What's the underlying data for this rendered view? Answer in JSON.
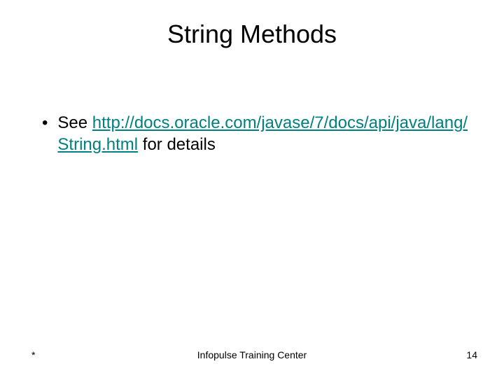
{
  "title": "String Methods",
  "bullet": {
    "prefix": "See ",
    "link_text": "http://docs.oracle.com/javase/7/docs/api/java/lang/String.html",
    "suffix": " for details"
  },
  "footer": {
    "left": "*",
    "center": "Infopulse Training Center",
    "right": "14"
  }
}
